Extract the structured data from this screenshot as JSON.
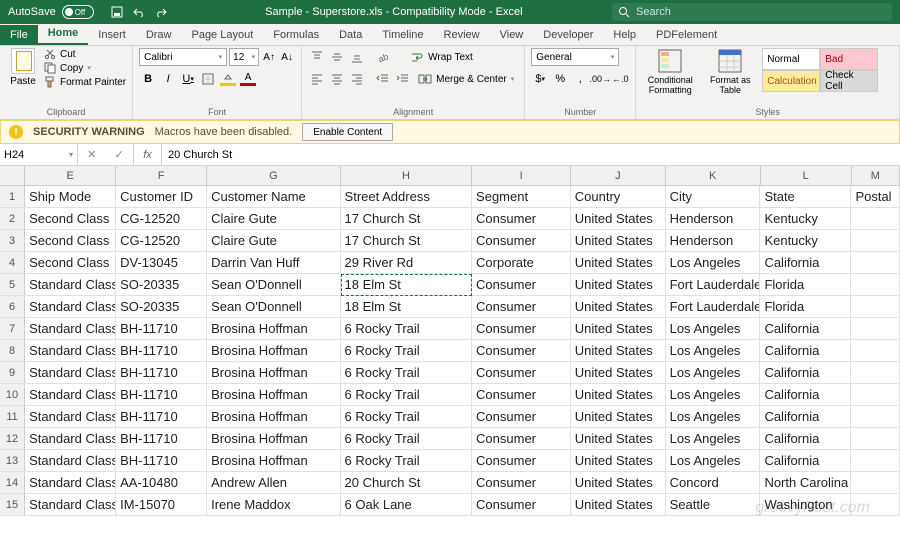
{
  "titlebar": {
    "autosave_label": "AutoSave",
    "autosave_state": "Off",
    "title": "Sample - Superstore.xls - Compatibility Mode - Excel",
    "search_placeholder": "Search"
  },
  "tabs": [
    "File",
    "Home",
    "Insert",
    "Draw",
    "Page Layout",
    "Formulas",
    "Data",
    "Timeline",
    "Review",
    "View",
    "Developer",
    "Help",
    "PDFelement"
  ],
  "active_tab": "Home",
  "ribbon": {
    "clipboard": {
      "paste": "Paste",
      "cut": "Cut",
      "copy": "Copy",
      "format_painter": "Format Painter",
      "label": "Clipboard"
    },
    "font": {
      "name": "Calibri",
      "size": "12",
      "label": "Font"
    },
    "alignment": {
      "wrap": "Wrap Text",
      "merge": "Merge & Center",
      "label": "Alignment"
    },
    "number": {
      "format": "General",
      "label": "Number"
    },
    "styles": {
      "cond": "Conditional Formatting",
      "table": "Format as Table",
      "normal": "Normal",
      "bad": "Bad",
      "calc": "Calculation",
      "check": "Check Cell",
      "label": "Styles"
    }
  },
  "warning": {
    "title": "SECURITY WARNING",
    "msg": "Macros have been disabled.",
    "btn": "Enable Content"
  },
  "namebox": "H24",
  "formula": "20 Church St",
  "columns": [
    "E",
    "F",
    "G",
    "H",
    "I",
    "J",
    "K",
    "L",
    "M"
  ],
  "col_widths": [
    "w-E",
    "w-F",
    "w-G",
    "w-H",
    "w-I",
    "w-J",
    "w-K",
    "w-L",
    "w-M"
  ],
  "headers": [
    "Ship Mode",
    "Customer ID",
    "Customer Name",
    "Street Address",
    "Segment",
    "Country",
    "City",
    "State",
    "Postal"
  ],
  "rows": [
    [
      "Second Class",
      "CG-12520",
      "Claire Gute",
      "17 Church St",
      "Consumer",
      "United States",
      "Henderson",
      "Kentucky",
      ""
    ],
    [
      "Second Class",
      "CG-12520",
      "Claire Gute",
      "17 Church St",
      "Consumer",
      "United States",
      "Henderson",
      "Kentucky",
      ""
    ],
    [
      "Second Class",
      "DV-13045",
      "Darrin Van Huff",
      "29 River Rd",
      "Corporate",
      "United States",
      "Los Angeles",
      "California",
      ""
    ],
    [
      "Standard Class",
      "SO-20335",
      "Sean O'Donnell",
      "18 Elm St",
      "Consumer",
      "United States",
      "Fort Lauderdale",
      "Florida",
      ""
    ],
    [
      "Standard Class",
      "SO-20335",
      "Sean O'Donnell",
      "18 Elm St",
      "Consumer",
      "United States",
      "Fort Lauderdale",
      "Florida",
      ""
    ],
    [
      "Standard Class",
      "BH-11710",
      "Brosina Hoffman",
      "6 Rocky Trail",
      "Consumer",
      "United States",
      "Los Angeles",
      "California",
      ""
    ],
    [
      "Standard Class",
      "BH-11710",
      "Brosina Hoffman",
      "6 Rocky Trail",
      "Consumer",
      "United States",
      "Los Angeles",
      "California",
      ""
    ],
    [
      "Standard Class",
      "BH-11710",
      "Brosina Hoffman",
      "6 Rocky Trail",
      "Consumer",
      "United States",
      "Los Angeles",
      "California",
      ""
    ],
    [
      "Standard Class",
      "BH-11710",
      "Brosina Hoffman",
      "6 Rocky Trail",
      "Consumer",
      "United States",
      "Los Angeles",
      "California",
      ""
    ],
    [
      "Standard Class",
      "BH-11710",
      "Brosina Hoffman",
      "6 Rocky Trail",
      "Consumer",
      "United States",
      "Los Angeles",
      "California",
      ""
    ],
    [
      "Standard Class",
      "BH-11710",
      "Brosina Hoffman",
      "6 Rocky Trail",
      "Consumer",
      "United States",
      "Los Angeles",
      "California",
      ""
    ],
    [
      "Standard Class",
      "BH-11710",
      "Brosina Hoffman",
      "6 Rocky Trail",
      "Consumer",
      "United States",
      "Los Angeles",
      "California",
      ""
    ],
    [
      "Standard Class",
      "AA-10480",
      "Andrew Allen",
      "20 Church St",
      "Consumer",
      "United States",
      "Concord",
      "North Carolina",
      ""
    ],
    [
      "Standard Class",
      "IM-15070",
      "Irene Maddox",
      "6 Oak Lane",
      "Consumer",
      "United States",
      "Seattle",
      "Washington",
      ""
    ]
  ],
  "marching_cell": {
    "row": 3,
    "col": 3
  },
  "watermark": "groovyPost.com"
}
